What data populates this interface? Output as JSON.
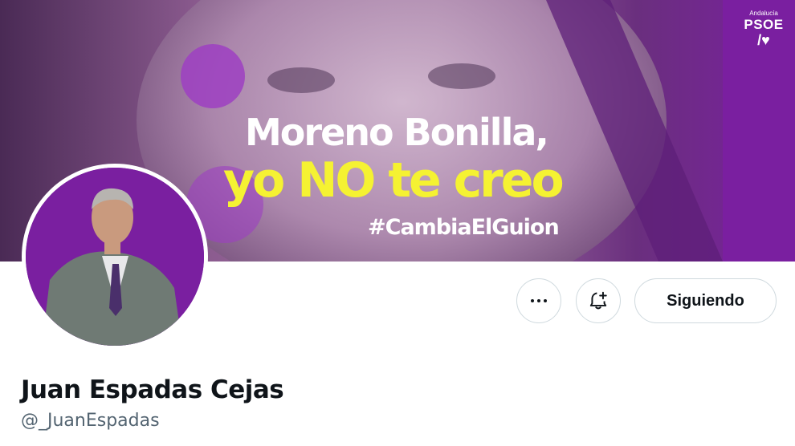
{
  "banner": {
    "line1": "Moreno Bonilla,",
    "line2": "yo NO te creo",
    "hashtag": "#CambiaElGuion",
    "party_region": "Andalucía",
    "party_name": "PSOE",
    "party_mark": "/♥",
    "colors": {
      "purple": "#7a1fa0",
      "yellow": "#f5f232"
    }
  },
  "profile": {
    "display_name": "Juan Espadas Cejas",
    "handle": "@_JuanEspadas"
  },
  "actions": {
    "more_icon": "more-dots-icon",
    "notify_icon": "bell-plus-icon",
    "following_label": "Siguiendo"
  }
}
